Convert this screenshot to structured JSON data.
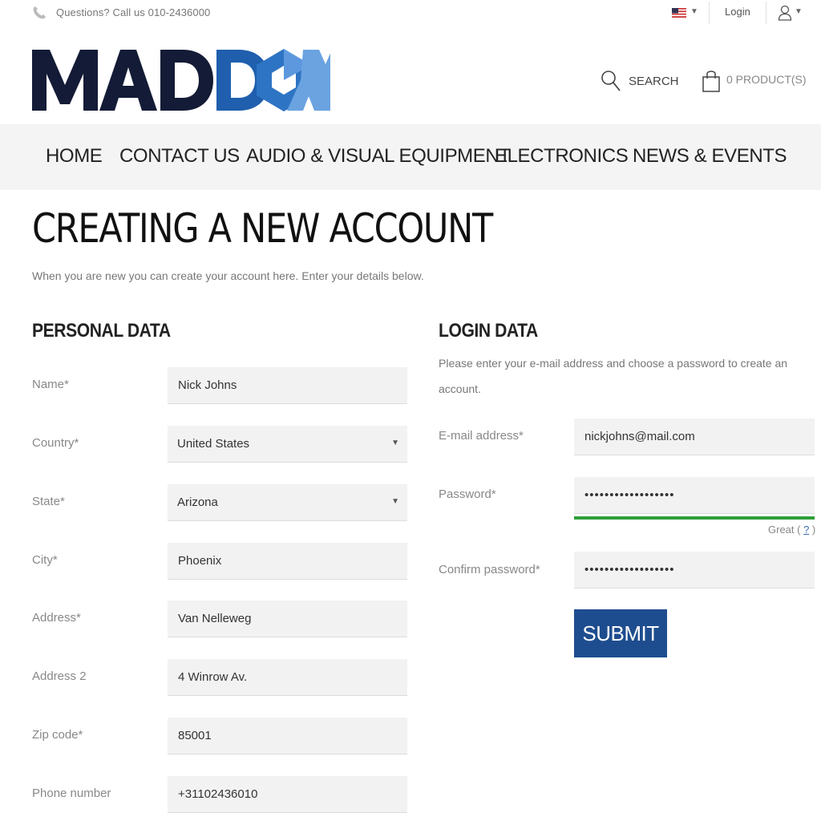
{
  "topbar": {
    "phone_text": "Questions? Call us 010-2436000",
    "login_label": "Login"
  },
  "logo": {
    "text": "MADDOX",
    "colors": {
      "dark": "#141b36",
      "blue": "#2e74c4",
      "light_blue": "#6aa3e0"
    }
  },
  "header": {
    "search_label": "SEARCH",
    "cart_label": "0 PRODUCT(S)"
  },
  "nav": {
    "items": [
      {
        "label": "HOME"
      },
      {
        "label": "CONTACT US"
      },
      {
        "label": "AUDIO & VISUAL EQUIPMENT"
      },
      {
        "label": "ELECTRONICS"
      },
      {
        "label": "NEWS & EVENTS"
      }
    ]
  },
  "page": {
    "title": "CREATING A NEW ACCOUNT",
    "subtitle": "When you are new you can create your account here. Enter your details below."
  },
  "personal": {
    "title": "PERSONAL DATA",
    "fields": [
      {
        "label": "Name*",
        "value": "Nick Johns"
      },
      {
        "label": "Country*",
        "value": "United States"
      },
      {
        "label": "State*",
        "value": "Arizona"
      },
      {
        "label": "City*",
        "value": "Phoenix"
      },
      {
        "label": "Address*",
        "value": "Van Nelleweg"
      },
      {
        "label": "Address 2",
        "value": "4 Winrow Av."
      },
      {
        "label": "Zip code*",
        "value": "85001"
      },
      {
        "label": "Phone number",
        "value": "+31102436010"
      }
    ]
  },
  "login": {
    "title": "LOGIN DATA",
    "description": "Please enter your e-mail address and choose a password to create an account.",
    "email_label": "E-mail address*",
    "email_value": "nickjohns@mail.com",
    "password_label": "Password*",
    "password_value": "••••••••••••••••••",
    "strength_text": "Great",
    "strength_help": "?",
    "confirm_label": "Confirm password*",
    "confirm_value": "••••••••••••••••••",
    "submit_label": "SUBMIT"
  },
  "colors": {
    "accent": "#1e4d8f",
    "strength": "#2e9e3a",
    "nav_bg": "#f4f4f4",
    "field_bg": "#f2f2f2"
  }
}
